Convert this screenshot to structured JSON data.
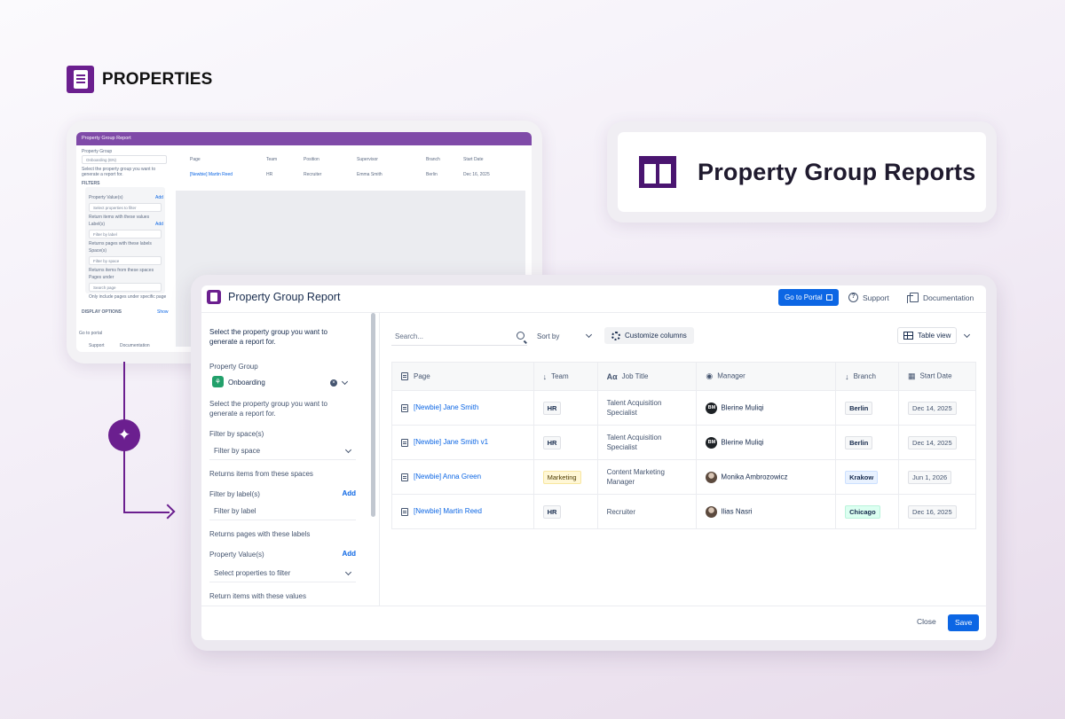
{
  "brand": {
    "name": "PROPERTIES"
  },
  "header_card": {
    "title": "Property Group Reports"
  },
  "back_window": {
    "title": "Property Group Report",
    "property_group_label": "Property Group",
    "property_group_value": "Onboarding (EN)",
    "helper": "Select the property group you want to generate a report for.",
    "filters_label": "FILTERS",
    "prop_values_label": "Property Value(s)",
    "add": "Add",
    "select_props": "Select properties to filter",
    "return_items": "Return items with these values",
    "labels_label": "Label(s)",
    "filter_label": "Filter by label",
    "returns_pages": "Returns pages with these labels",
    "spaces_label": "Space(s)",
    "filter_space": "Filter by space",
    "returns_spaces": "Returns items from these spaces",
    "pages_under": "Pages under",
    "search_page": "Search page",
    "only_include": "Only include pages under specific page",
    "display_options": "DISPLAY OPTIONS",
    "show": "Show",
    "go_to_portal": "Go to portal",
    "support": "Support",
    "documentation": "Documentation",
    "cols": [
      "Page",
      "Team",
      "Position",
      "Supervisor",
      "Branch",
      "Start Date"
    ],
    "row": {
      "page": "[Newbie] Martin Reed",
      "team": "HR",
      "position": "Recruiter",
      "supervisor": "Emma Smith",
      "branch": "Berlin",
      "date": "Dec 16, 2025"
    }
  },
  "modal": {
    "title": "Property Group Report",
    "go_portal": "Go to Portal",
    "support": "Support",
    "documentation": "Documentation",
    "close": "Close",
    "save": "Save"
  },
  "sidebar": {
    "intro": "Select the property group you want to generate a report for.",
    "property_group_label": "Property Group",
    "property_group_value": "Onboarding",
    "helper": "Select the property group you want to generate a report for.",
    "space_label": "Filter by space(s)",
    "space_placeholder": "Filter by space",
    "space_helper": "Returns items from these spaces",
    "label_label": "Filter by label(s)",
    "add": "Add",
    "label_placeholder": "Filter by label",
    "label_helper": "Returns pages with these labels",
    "prop_label": "Property Value(s)",
    "prop_placeholder": "Select properties to filter",
    "prop_helper": "Return items with these values"
  },
  "toolbar": {
    "search_placeholder": "Search...",
    "sort_by": "Sort by",
    "customize": "Customize columns",
    "table_view": "Table view"
  },
  "table": {
    "headers": [
      "Page",
      "Team",
      "Job Title",
      "Manager",
      "Branch",
      "Start Date"
    ],
    "rows": [
      {
        "page": "[Newbie] Jane Smith",
        "team": "HR",
        "job": "Talent Acquisition Specialist",
        "manager_initials": "BM",
        "manager": "Blerine Muliqi",
        "branch": "Berlin",
        "date": "Dec 14, 2025"
      },
      {
        "page": "[Newbie] Jane Smith v1",
        "team": "HR",
        "job": "Talent Acquisition Specialist",
        "manager_initials": "BM",
        "manager": "Blerine Muliqi",
        "branch": "Berlin",
        "date": "Dec 14, 2025"
      },
      {
        "page": "[Newbie] Anna Green",
        "team": "Marketing",
        "job": "Content Marketing Manager",
        "manager_initials": "",
        "manager": "Monika Ambrozowicz",
        "branch": "Krakow",
        "date": "Jun 1, 2026"
      },
      {
        "page": "[Newbie] Martin Reed",
        "team": "HR",
        "job": "Recruiter",
        "manager_initials": "",
        "manager": "Ilias Nasri",
        "branch": "Chicago",
        "date": "Dec 16, 2025"
      }
    ]
  },
  "colors": {
    "brand": "#6b1f8f",
    "primary": "#0c66e4"
  }
}
